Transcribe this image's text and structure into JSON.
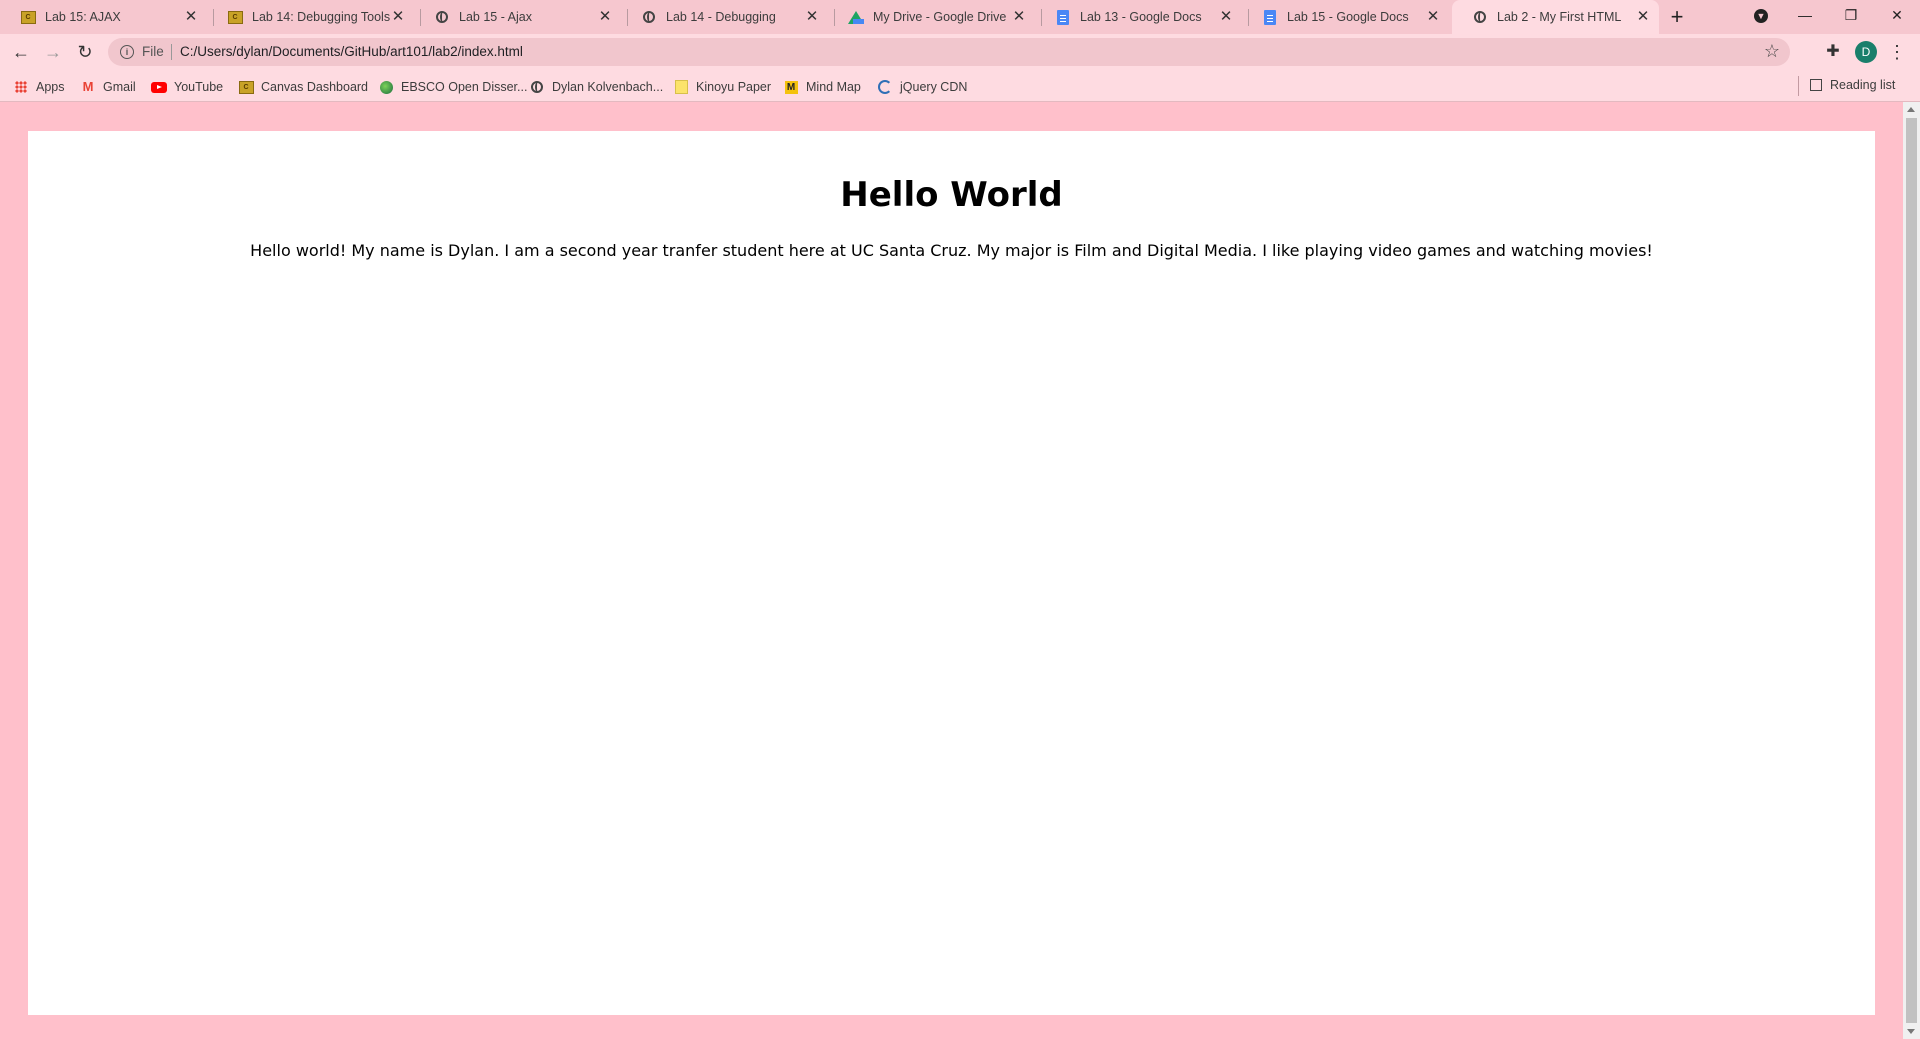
{
  "tabs": [
    {
      "title": "Lab 15: AJAX",
      "icon": "canvas-icon"
    },
    {
      "title": "Lab 14: Debugging Tools &",
      "icon": "canvas-icon"
    },
    {
      "title": "Lab 15 - Ajax",
      "icon": "globe-icon"
    },
    {
      "title": "Lab 14 - Debugging",
      "icon": "globe-icon"
    },
    {
      "title": "My Drive - Google Drive",
      "icon": "google-drive-icon"
    },
    {
      "title": "Lab 13 - Google Docs",
      "icon": "google-docs-icon"
    },
    {
      "title": "Lab 15 - Google Docs",
      "icon": "google-docs-icon"
    },
    {
      "title": "Lab 2 - My First HTML",
      "icon": "globe-icon",
      "active": true
    }
  ],
  "address": {
    "scheme_label": "File",
    "url": "C:/Users/dylan/Documents/GitHub/art101/lab2/index.html"
  },
  "profile": {
    "initial": "D",
    "color": "#1a7f6b"
  },
  "bookmarks": [
    {
      "label": "Apps",
      "icon": "apps-grid-icon"
    },
    {
      "label": "Gmail",
      "icon": "gmail-icon"
    },
    {
      "label": "YouTube",
      "icon": "youtube-icon"
    },
    {
      "label": "Canvas Dashboard",
      "icon": "canvas-icon"
    },
    {
      "label": "EBSCO Open Disser...",
      "icon": "ebsco-icon"
    },
    {
      "label": "Dylan Kolvenbach...",
      "icon": "globe-icon"
    },
    {
      "label": "Kinoyu Paper",
      "icon": "folder-icon"
    },
    {
      "label": "Mind Map",
      "icon": "mind-map-icon"
    },
    {
      "label": "jQuery CDN",
      "icon": "jquery-icon"
    }
  ],
  "reading_list": "Reading list",
  "page": {
    "heading": "Hello World",
    "paragraph": "Hello world! My name is Dylan. I am a second year tranfer student here at UC Santa Cruz. My major is Film and Digital Media. I like playing video games and watching movies!",
    "background_color": "#ffc0cb",
    "card_color": "#ffffff"
  }
}
